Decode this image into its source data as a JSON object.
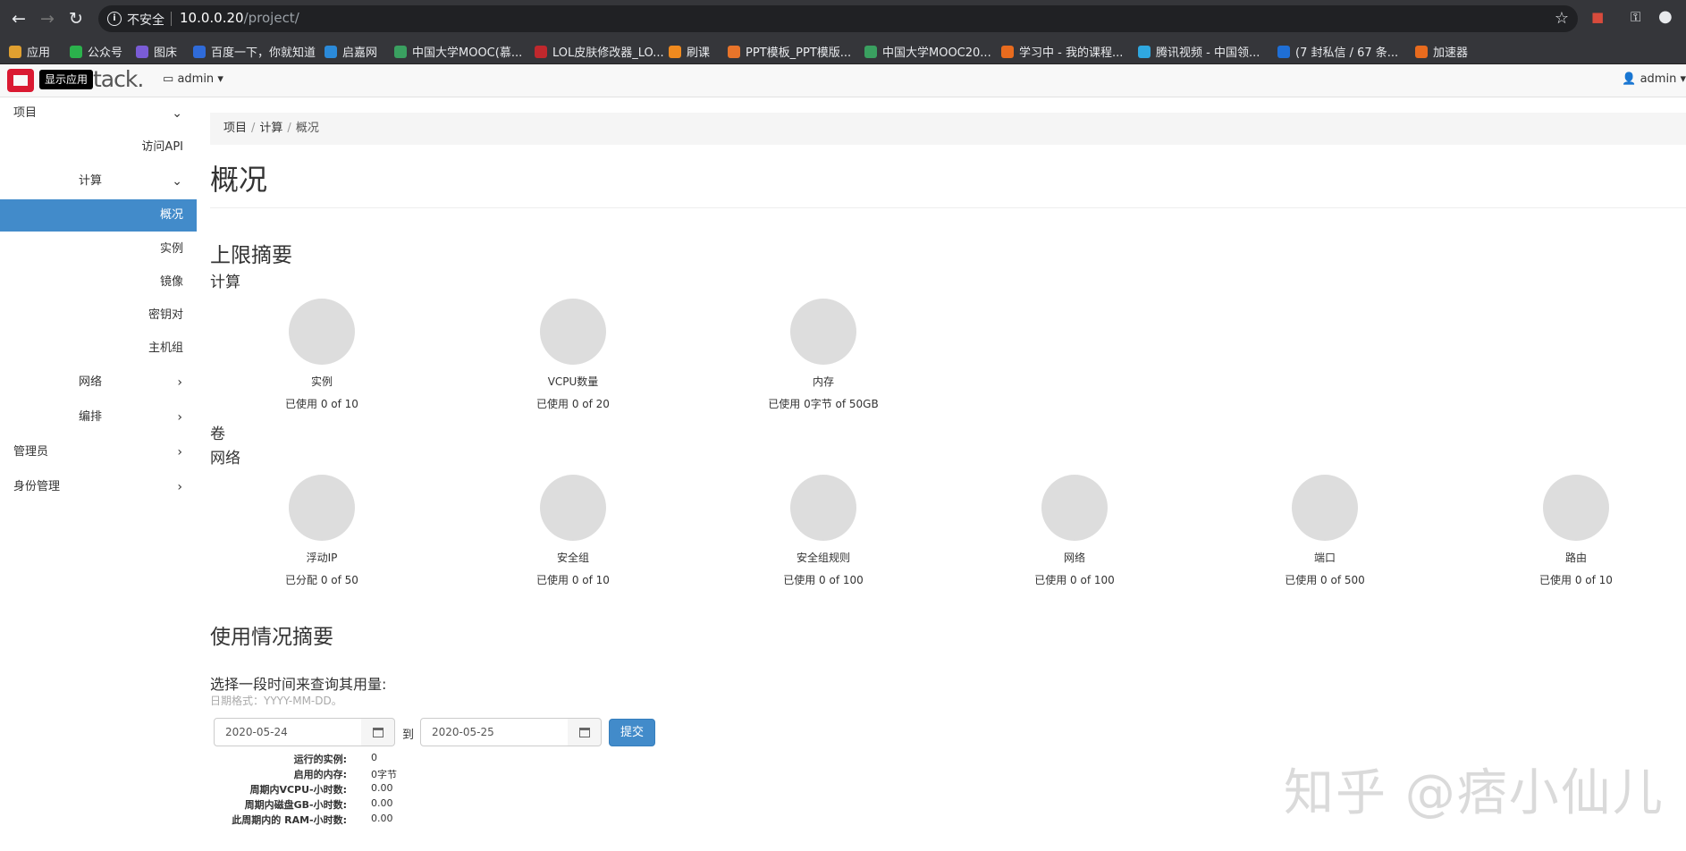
{
  "browser": {
    "insecure_label": "不安全",
    "url_host": "10.0.0.20",
    "url_path": "/project/",
    "bookmarks": [
      {
        "label": "应用",
        "color": "#e0a030"
      },
      {
        "label": "公众号",
        "color": "#2bb24c"
      },
      {
        "label": "图床",
        "color": "#7a5cd6"
      },
      {
        "label": "百度一下，你就知道",
        "color": "#2f6bd9"
      },
      {
        "label": "启嘉网",
        "color": "#2b8ad9"
      },
      {
        "label": "中国大学MOOC(慕...",
        "color": "#3aa060"
      },
      {
        "label": "LOL皮肤修改器_LO...",
        "color": "#c0282d"
      },
      {
        "label": "刷课",
        "color": "#f08a1e"
      },
      {
        "label": "PPT模板_PPT模版...",
        "color": "#e8742a"
      },
      {
        "label": "中国大学MOOC20...",
        "color": "#3aa060"
      },
      {
        "label": "学习中 - 我的课程...",
        "color": "#e86b1e"
      },
      {
        "label": "腾讯视频 - 中国领...",
        "color": "#2fa8e0"
      },
      {
        "label": "(7 封私信 / 67 条...",
        "color": "#1f6fd6"
      },
      {
        "label": "加速器",
        "color": "#e86b1e"
      }
    ]
  },
  "header": {
    "tooltip": "显示应用",
    "logo_text": "tack.",
    "project": "admin",
    "user": "admin"
  },
  "sidebar": {
    "project": "项目",
    "api_access": "访问API",
    "compute": "计算",
    "overview": "概况",
    "instances": "实例",
    "images": "镜像",
    "keypairs": "密钥对",
    "host_groups": "主机组",
    "network": "网络",
    "orchestration": "编排",
    "admin": "管理员",
    "identity": "身份管理"
  },
  "breadcrumb": [
    "项目",
    "计算",
    "概况"
  ],
  "page_title": "概况",
  "limit_summary": {
    "heading": "上限摘要",
    "compute_heading": "计算",
    "compute": [
      {
        "title": "实例",
        "sub": "已使用 0 of 10"
      },
      {
        "title": "VCPU数量",
        "sub": "已使用 0 of 20"
      },
      {
        "title": "内存",
        "sub": "已使用 0字节 of 50GB"
      }
    ],
    "volume_heading": "卷",
    "network_heading": "网络",
    "network": [
      {
        "title": "浮动IP",
        "sub": "已分配 0 of 50"
      },
      {
        "title": "安全组",
        "sub": "已使用 0 of 10"
      },
      {
        "title": "安全组规则",
        "sub": "已使用 0 of 100"
      },
      {
        "title": "网络",
        "sub": "已使用 0 of 100"
      },
      {
        "title": "端口",
        "sub": "已使用 0 of 500"
      },
      {
        "title": "路由",
        "sub": "已使用 0 of 10"
      }
    ]
  },
  "usage": {
    "heading": "使用情况摘要",
    "query_label": "选择一段时间来查询其用量:",
    "date_hint": "日期格式：YYYY-MM-DD。",
    "start_date": "2020-05-24",
    "to_label": "到",
    "end_date": "2020-05-25",
    "submit": "提交",
    "stats": [
      {
        "k": "运行的实例:",
        "v": "0"
      },
      {
        "k": "启用的内存:",
        "v": "0字节"
      },
      {
        "k": "周期内VCPU-小时数:",
        "v": "0.00"
      },
      {
        "k": "周期内磁盘GB-小时数:",
        "v": "0.00"
      },
      {
        "k": "此周期内的 RAM-小时数:",
        "v": "0.00"
      }
    ]
  },
  "watermark": "知乎 @痞小仙儿"
}
